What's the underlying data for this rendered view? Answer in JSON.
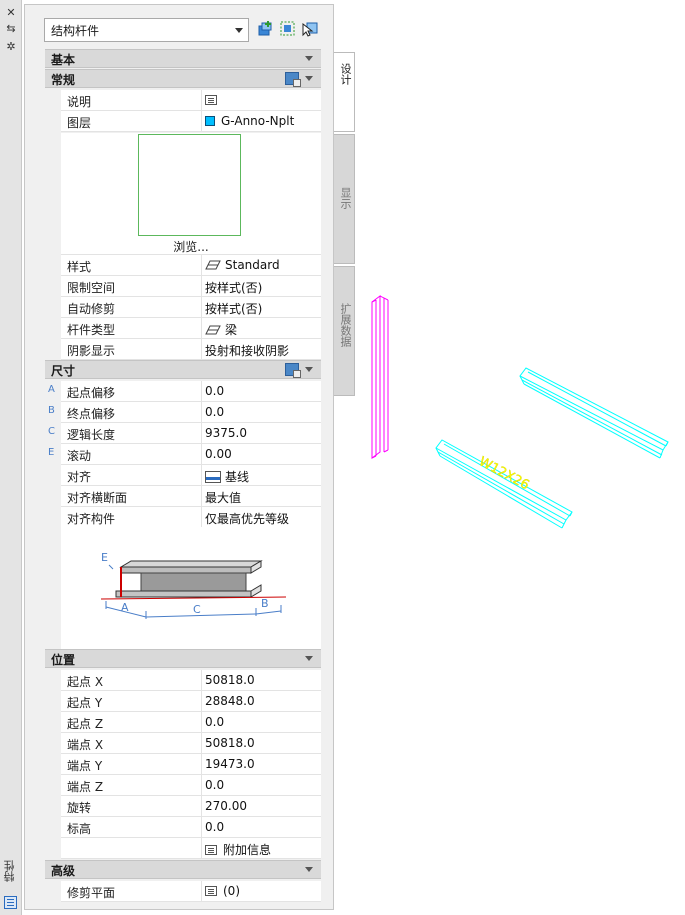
{
  "sidebar": {
    "title": "特性",
    "buttons": [
      "✕",
      "⇆",
      "✲"
    ]
  },
  "header": {
    "object_type": "结构杆件"
  },
  "sections": {
    "basic": "基本",
    "general": "常规",
    "dimensions": "尺寸",
    "location": "位置",
    "advanced": "高级"
  },
  "general": {
    "description_label": "说明",
    "layer_label": "图层",
    "layer_value": "G-Anno-Nplt",
    "browse_label": "浏览...",
    "style_label": "样式",
    "style_value": "Standard",
    "bound_label": "限制空间",
    "bound_value": "按样式(否)",
    "trim_label": "自动修剪",
    "trim_value": "按样式(否)",
    "member_type_label": "杆件类型",
    "member_type_value": "梁",
    "shadow_label": "阴影显示",
    "shadow_value": "投射和接收阴影"
  },
  "dimensions": {
    "start_offset_label": "起点偏移",
    "start_offset_value": "0.0",
    "end_offset_label": "终点偏移",
    "end_offset_value": "0.0",
    "logical_length_label": "逻辑长度",
    "logical_length_value": "9375.0",
    "roll_label": "滚动",
    "roll_value": "0.00",
    "justify_label": "对齐",
    "justify_value": "基线",
    "justify_section_label": "对齐横断面",
    "justify_section_value": "最大值",
    "justify_component_label": "对齐构件",
    "justify_component_value": "仅最高优先等级",
    "letters": {
      "a": "A",
      "b": "B",
      "c": "C",
      "e": "E"
    }
  },
  "location": {
    "start_x_label": "起点 X",
    "start_x_value": "50818.0",
    "start_y_label": "起点 Y",
    "start_y_value": "28848.0",
    "start_z_label": "起点 Z",
    "start_z_value": "0.0",
    "end_x_label": "端点 X",
    "end_x_value": "50818.0",
    "end_y_label": "端点 Y",
    "end_y_value": "19473.0",
    "end_z_label": "端点 Z",
    "end_z_value": "0.0",
    "rotation_label": "旋转",
    "rotation_value": "270.00",
    "elevation_label": "标高",
    "elevation_value": "0.0",
    "additional_info": "附加信息"
  },
  "advanced": {
    "trim_planes_label": "修剪平面",
    "trim_planes_value": "(0)"
  },
  "tabs": [
    "设计",
    "显示",
    "扩展数据"
  ],
  "drawing": {
    "beam_label": "W12X26",
    "colors": {
      "magenta": "#ff00ff",
      "cyan": "#00ffff",
      "yellow": "#ffff00"
    }
  }
}
